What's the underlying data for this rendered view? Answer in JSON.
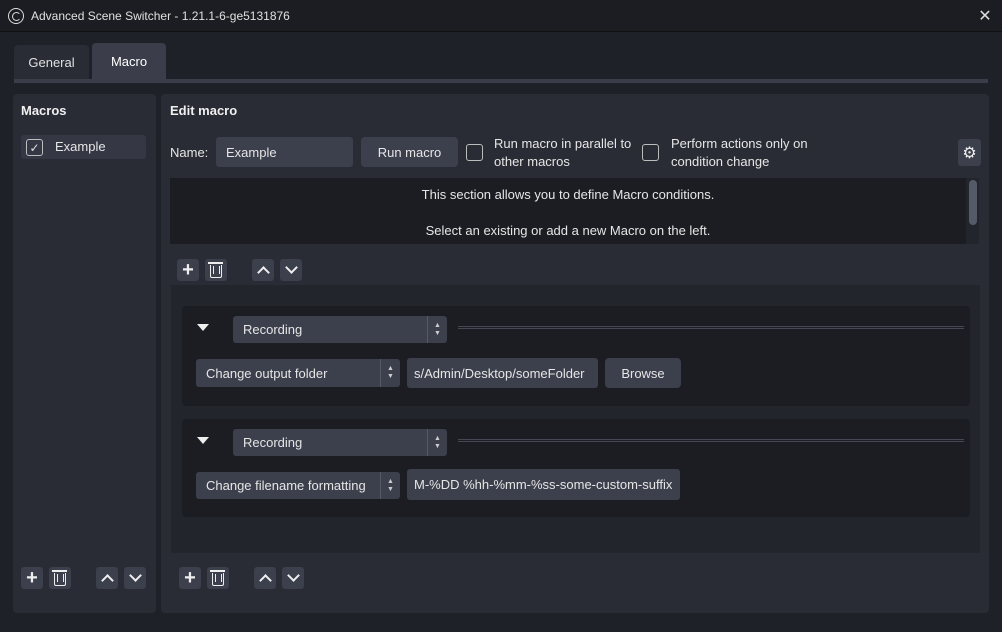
{
  "window": {
    "title": "Advanced Scene Switcher - 1.21.1-6-ge5131876",
    "close_symbol": "✕"
  },
  "tabs": [
    {
      "label": "General"
    },
    {
      "label": "Macro"
    }
  ],
  "macros_panel": {
    "title": "Macros",
    "items": [
      {
        "label": "Example",
        "checked": true,
        "check_symbol": "✓"
      }
    ]
  },
  "edit_panel": {
    "title": "Edit macro",
    "name_label": "Name:",
    "name_value": "Example",
    "run_macro_label": "Run macro",
    "parallel_label_line1": "Run macro in parallel to",
    "parallel_label_line2": "other macros",
    "perform_label_line1": "Perform actions only on",
    "perform_label_line2": "condition change",
    "settings_symbol": "⚙",
    "conditions_info": [
      "This section allows you to define Macro conditions.",
      "Select an existing or add a new Macro on the left."
    ],
    "actions": [
      {
        "type": "Recording",
        "subtype": "Change output folder",
        "value": "s/Admin/Desktop/someFolder",
        "browse_label": "Browse"
      },
      {
        "type": "Recording",
        "subtype": "Change filename formatting",
        "value": "M-%DD %hh-%mm-%ss-some-custom-suffix"
      }
    ]
  },
  "toolbar": {
    "plus_symbol": "+"
  },
  "colors": {
    "background": "#1f2128",
    "panel": "#2a2c35",
    "control": "#3c3f4c",
    "active_tab": "#3b3e4a"
  }
}
